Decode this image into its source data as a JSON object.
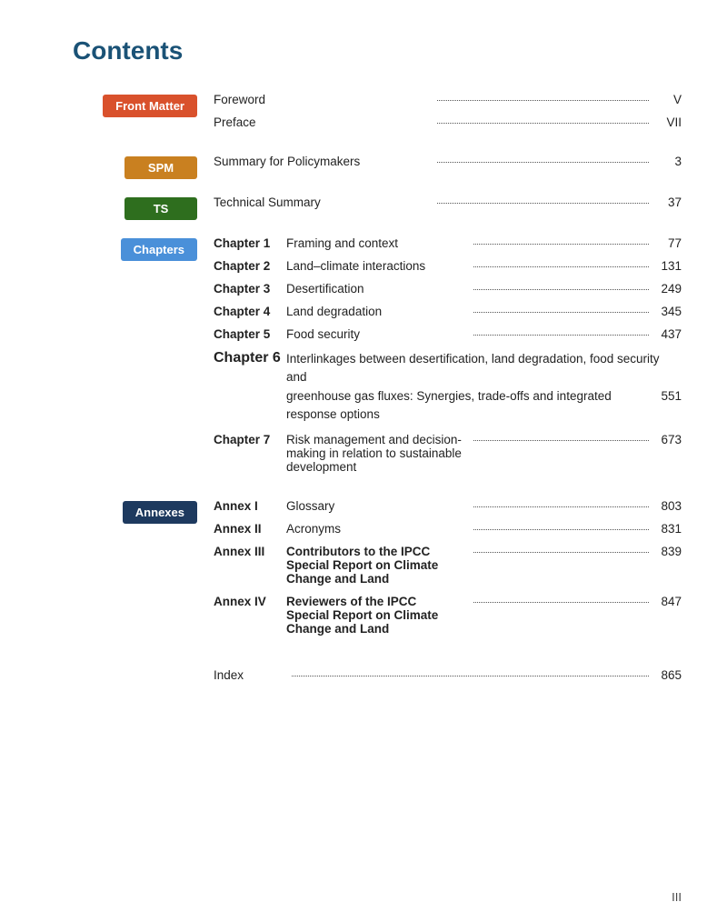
{
  "title": "Contents",
  "sections": [
    {
      "id": "front-matter",
      "label": "Front Matter",
      "label_class": "label-front-matter",
      "entries": [
        {
          "num": "",
          "title": "Foreword",
          "page": "V",
          "bold": false
        },
        {
          "num": "",
          "title": "Preface",
          "page": "VII",
          "bold": false
        }
      ]
    },
    {
      "id": "spm",
      "label": "SPM",
      "label_class": "label-spm",
      "entries": [
        {
          "num": "",
          "title": "Summary for Policymakers",
          "page": "3",
          "bold": false
        }
      ]
    },
    {
      "id": "ts",
      "label": "TS",
      "label_class": "label-ts",
      "entries": [
        {
          "num": "",
          "title": "Technical Summary",
          "page": "37",
          "bold": false
        }
      ]
    },
    {
      "id": "chapters",
      "label": "Chapters",
      "label_class": "label-chapters",
      "entries": [
        {
          "num": "Chapter 1",
          "title": "Framing and context",
          "page": "77",
          "bold": false
        },
        {
          "num": "Chapter 2",
          "title": "Land–climate interactions",
          "page": "131",
          "bold": false
        },
        {
          "num": "Chapter 3",
          "title": "Desertification",
          "page": "249",
          "bold": false
        },
        {
          "num": "Chapter 4",
          "title": "Land degradation",
          "page": "345",
          "bold": false
        },
        {
          "num": "Chapter 5",
          "title": "Food security",
          "page": "437",
          "bold": false
        },
        {
          "num": "Chapter 6",
          "title_line1": "Interlinkages between desertification, land degradation, food security and",
          "title_line2": "greenhouse gas fluxes: Synergies, trade-offs and integrated response options",
          "page": "551",
          "multiline": true,
          "bold": false
        },
        {
          "num": "Chapter 7",
          "title": "Risk management and decision-making in relation to sustainable development",
          "page": "673",
          "bold": false
        }
      ]
    },
    {
      "id": "annexes",
      "label": "Annexes",
      "label_class": "label-annexes",
      "entries": [
        {
          "num": "Annex I",
          "title": "Glossary",
          "page": "803",
          "bold": false
        },
        {
          "num": "Annex II",
          "title": "Acronyms",
          "page": "831",
          "bold": false
        },
        {
          "num": "Annex III",
          "title": "Contributors to the IPCC Special Report on Climate Change and Land",
          "page": "839",
          "bold": true
        },
        {
          "num": "Annex IV",
          "title": "Reviewers of the IPCC Special Report on Climate Change and Land",
          "page": "847",
          "bold": true
        }
      ]
    }
  ],
  "index": {
    "label": "Index",
    "page": "865"
  },
  "page_number": "III"
}
